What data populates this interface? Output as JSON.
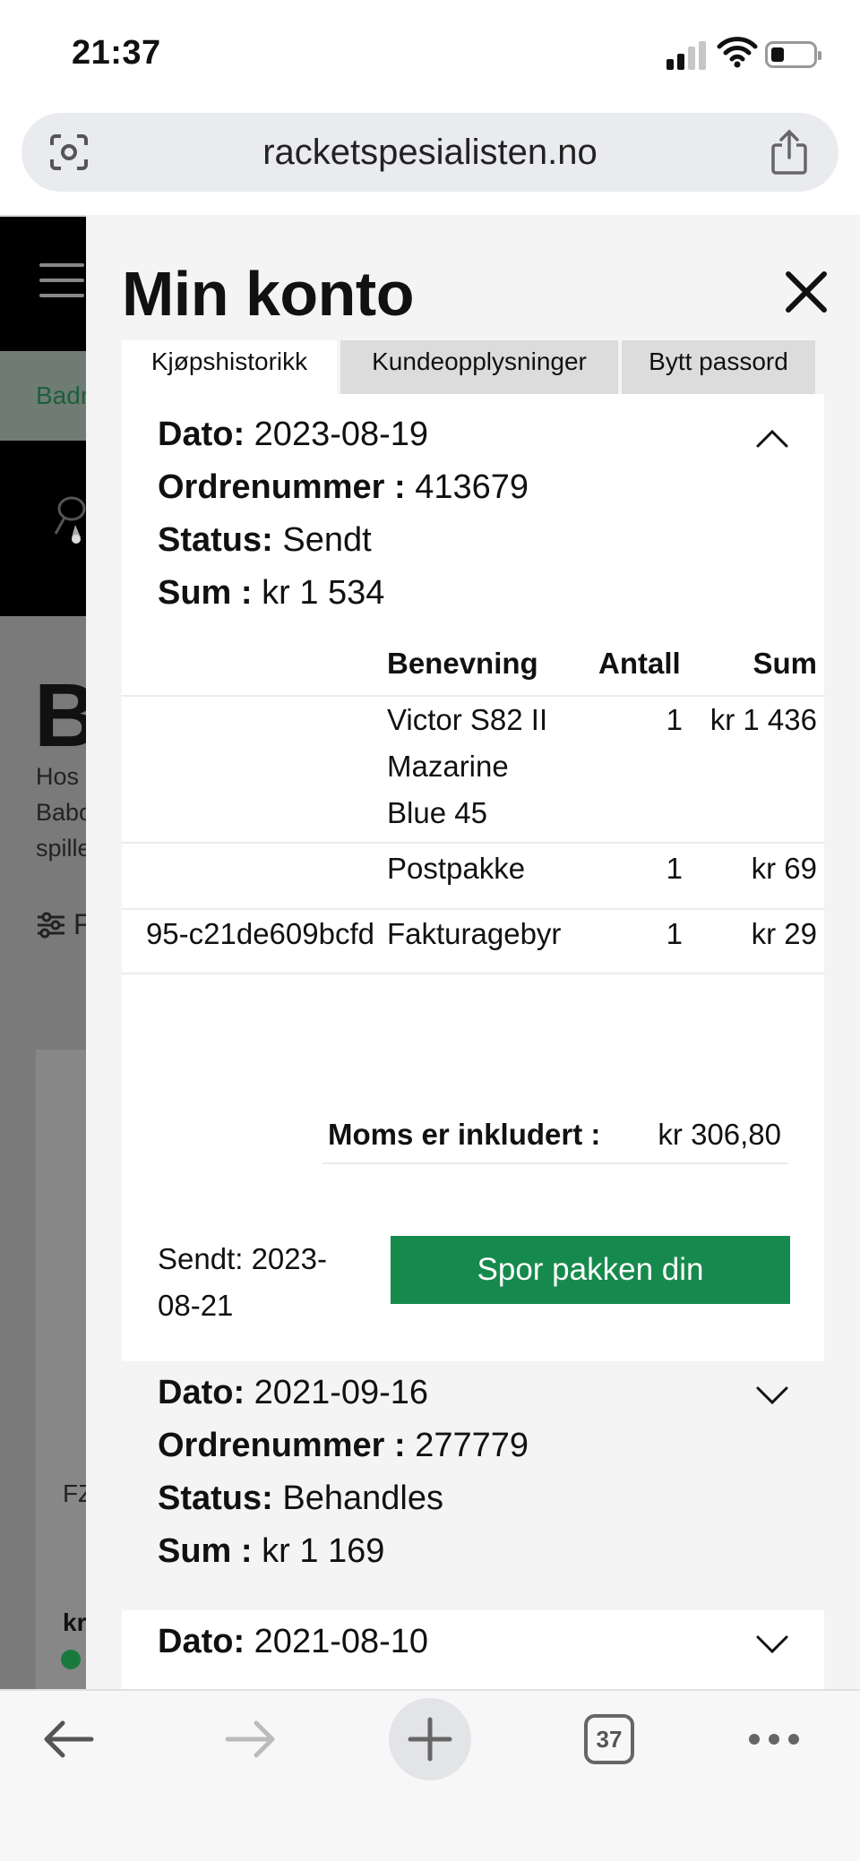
{
  "status_bar": {
    "time": "21:37"
  },
  "browser": {
    "url": "racketspesialisten.no",
    "tab_count": "37"
  },
  "background_page": {
    "breadcrumb_fragment": "Badr",
    "heading_fragment": "B",
    "text_fragments": [
      "Hos",
      "Babo",
      "spille"
    ],
    "filter_fragment": "F",
    "product_fragment": "FZ",
    "price_fragment": "kr"
  },
  "modal": {
    "title": "Min konto",
    "tabs": [
      {
        "label": "Kjøpshistorikk",
        "active": true
      },
      {
        "label": "Kundeopplysninger",
        "active": false
      },
      {
        "label": "Bytt passord",
        "active": false
      }
    ],
    "labels": {
      "date": "Dato:",
      "order_number": "Ordrenummer :",
      "status": "Status:",
      "sum": "Sum :"
    },
    "orders": [
      {
        "date": "2023-08-19",
        "order_number": "413679",
        "status": "Sendt",
        "sum": "kr 1 534",
        "expanded": true,
        "table": {
          "headers": [
            "Benevning",
            "Antall",
            "Sum"
          ],
          "rows": [
            {
              "id": "",
              "name_lines": [
                "Victor S82 II",
                "Mazarine",
                "Blue 45"
              ],
              "qty": "1",
              "sum": "kr 1 436"
            },
            {
              "id": "",
              "name_lines": [
                "Postpakke"
              ],
              "qty": "1",
              "sum": "kr 69"
            },
            {
              "id": "95-c21de609bcfd",
              "name_lines": [
                "Fakturagebyr"
              ],
              "qty": "1",
              "sum": "kr 29"
            }
          ]
        },
        "vat_label": "Moms er inkludert :",
        "vat_value": "kr 306,80",
        "sent_lines": [
          "Sendt: 2023-",
          "08-21"
        ],
        "track_button": "Spor pakken din"
      },
      {
        "date": "2021-09-16",
        "order_number": "277779",
        "status": "Behandles",
        "sum": "kr 1 169",
        "expanded": false
      },
      {
        "date": "2021-08-10",
        "expanded": false
      }
    ]
  },
  "colors": {
    "accent_green": "#168a4c",
    "overlay_gray": "#7a7a7a",
    "modal_bg": "#f4f4f4"
  },
  "icons": [
    "camera-search-icon",
    "share-icon",
    "close-icon",
    "chevron-up-icon",
    "chevron-down-icon",
    "back-arrow-icon",
    "forward-arrow-icon",
    "new-tab-plus-icon",
    "tabs-icon",
    "more-icon"
  ]
}
